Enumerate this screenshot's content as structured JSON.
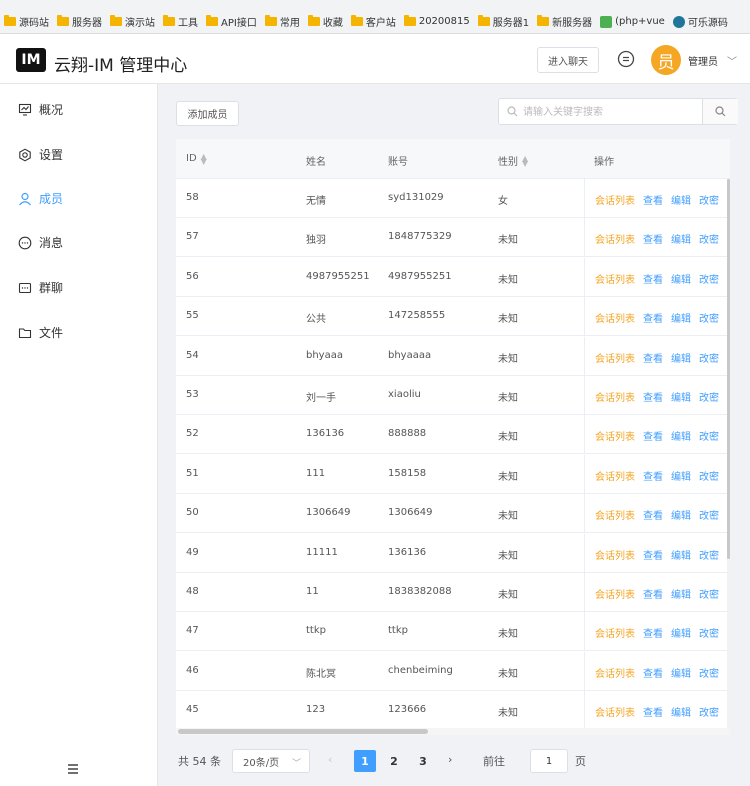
{
  "bookmarks": [
    {
      "label": "源码站",
      "icon": "folder-icon"
    },
    {
      "label": "服务器",
      "icon": "folder-icon"
    },
    {
      "label": "演示站",
      "icon": "folder-icon"
    },
    {
      "label": "工具",
      "icon": "folder-icon"
    },
    {
      "label": "API接口",
      "icon": "folder-icon"
    },
    {
      "label": "常用",
      "icon": "folder-icon"
    },
    {
      "label": "收藏",
      "icon": "folder-icon"
    },
    {
      "label": "客户站",
      "icon": "folder-icon"
    },
    {
      "label": "20200815",
      "icon": "folder-icon"
    },
    {
      "label": "服务器1",
      "icon": "folder-icon"
    },
    {
      "label": "新服务器",
      "icon": "folder-icon"
    },
    {
      "label": "(php+vue",
      "icon": "image-icon"
    },
    {
      "label": "可乐源码",
      "icon": "wordpress-icon"
    }
  ],
  "header": {
    "logo": "IM",
    "title": "云翔-IM 管理中心",
    "enter_chat": "进入聊天",
    "avatar_char": "员",
    "user_name": "管理员"
  },
  "sidebar": {
    "items": [
      {
        "label": "概况",
        "icon": "overview-icon",
        "active": false
      },
      {
        "label": "设置",
        "icon": "settings-icon",
        "active": false
      },
      {
        "label": "成员",
        "icon": "user-icon",
        "active": true
      },
      {
        "label": "消息",
        "icon": "message-icon",
        "active": false
      },
      {
        "label": "群聊",
        "icon": "group-chat-icon",
        "active": false
      },
      {
        "label": "文件",
        "icon": "folder-icon",
        "active": false
      }
    ]
  },
  "toolbar": {
    "add_label": "添加成员",
    "search_placeholder": "请输入关键字搜索"
  },
  "table": {
    "headers": {
      "id": "ID",
      "name": "姓名",
      "account": "账号",
      "gender": "性别",
      "ops": "操作"
    },
    "ops": {
      "list": "会话列表",
      "view": "查看",
      "edit": "编辑",
      "pwd": "改密"
    },
    "rows": [
      {
        "id": "58",
        "name": "无情",
        "account": "syd131029",
        "gender": "女"
      },
      {
        "id": "57",
        "name": "独羽",
        "account": "1848775329",
        "gender": "未知"
      },
      {
        "id": "56",
        "name": "4987955251",
        "account": "4987955251",
        "gender": "未知"
      },
      {
        "id": "55",
        "name": "公共",
        "account": "147258555",
        "gender": "未知"
      },
      {
        "id": "54",
        "name": "bhyaaa",
        "account": "bhyaaaa",
        "gender": "未知"
      },
      {
        "id": "53",
        "name": "刘一手",
        "account": "xiaoliu",
        "gender": "未知"
      },
      {
        "id": "52",
        "name": "136136",
        "account": "888888",
        "gender": "未知"
      },
      {
        "id": "51",
        "name": "111",
        "account": "158158",
        "gender": "未知"
      },
      {
        "id": "50",
        "name": "1306649",
        "account": "1306649",
        "gender": "未知"
      },
      {
        "id": "49",
        "name": "11111",
        "account": "136136",
        "gender": "未知"
      },
      {
        "id": "48",
        "name": "11",
        "account": "1838382088",
        "gender": "未知"
      },
      {
        "id": "47",
        "name": "ttkp",
        "account": "ttkp",
        "gender": "未知"
      },
      {
        "id": "46",
        "name": "陈北冥",
        "account": "chenbeiming",
        "gender": "未知"
      },
      {
        "id": "45",
        "name": "123",
        "account": "123666",
        "gender": "未知"
      }
    ]
  },
  "pagination": {
    "total": "共 54 条",
    "page_size": "20条/页",
    "pages": [
      "1",
      "2",
      "3"
    ],
    "current_page": "1",
    "goto_label": "前往",
    "goto_value": "1",
    "page_suffix": "页"
  }
}
